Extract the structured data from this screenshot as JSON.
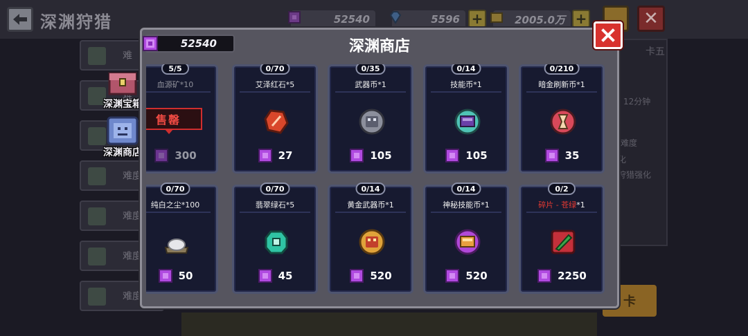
{
  "background": {
    "title": "深渊狩猎",
    "resources": [
      {
        "value": "52540",
        "icon": "purple-gem-icon"
      },
      {
        "value": "5596",
        "icon": "blue-gem-icon"
      },
      {
        "value": "2005.0万",
        "icon": "gold-coin-icon"
      }
    ],
    "side_rows": [
      "难",
      "难",
      "难",
      "难度",
      "难度",
      "难度",
      "难度"
    ],
    "side_tabs": [
      {
        "label": "深渊宝箱",
        "icon": "chest-icon"
      },
      {
        "label": "深渊商店",
        "icon": "shop-icon"
      }
    ],
    "right_panel": {
      "tab": "卡五",
      "time": "12分钟",
      "texts": [
        "难度",
        "化",
        "狩猎强化"
      ]
    },
    "gold_button": "卡"
  },
  "shop": {
    "title": "深渊商店",
    "currency": "52540",
    "sold_label": "售罄",
    "items": [
      {
        "count": "5/5",
        "name": "血源矿",
        "qty": "*10",
        "price": "300",
        "sold": true,
        "icon": "blood-ore-icon"
      },
      {
        "count": "0/70",
        "name": "艾泽红石",
        "qty": "*5",
        "price": "27",
        "sold": false,
        "icon": "red-stone-icon"
      },
      {
        "count": "0/35",
        "name": "武器币",
        "qty": "*1",
        "price": "105",
        "sold": false,
        "icon": "weapon-coin-icon"
      },
      {
        "count": "0/14",
        "name": "技能币",
        "qty": "*1",
        "price": "105",
        "sold": false,
        "icon": "skill-coin-icon"
      },
      {
        "count": "0/210",
        "name": "暗金刷新币",
        "qty": "*1",
        "price": "35",
        "sold": false,
        "icon": "refresh-coin-icon"
      },
      {
        "count": "0/70",
        "name": "纯白之尘",
        "qty": "*100",
        "price": "50",
        "sold": false,
        "icon": "white-dust-icon"
      },
      {
        "count": "0/70",
        "name": "翡翠绿石",
        "qty": "*5",
        "price": "45",
        "sold": false,
        "icon": "green-stone-icon"
      },
      {
        "count": "0/14",
        "name": "黄金武器币",
        "qty": "*1",
        "price": "520",
        "sold": false,
        "icon": "gold-weapon-coin-icon"
      },
      {
        "count": "0/14",
        "name": "神秘技能币",
        "qty": "*1",
        "price": "520",
        "sold": false,
        "icon": "mystic-skill-coin-icon"
      },
      {
        "count": "0/2",
        "name": "碎片 - 苍绿",
        "qty": "*1",
        "price": "2250",
        "sold": false,
        "name_color": "#e83a32",
        "icon": "green-shard-icon"
      }
    ]
  },
  "colors": {
    "accent_purple": "#a43fd6",
    "close_red": "#d8322e",
    "card_bg": "#171a30"
  }
}
